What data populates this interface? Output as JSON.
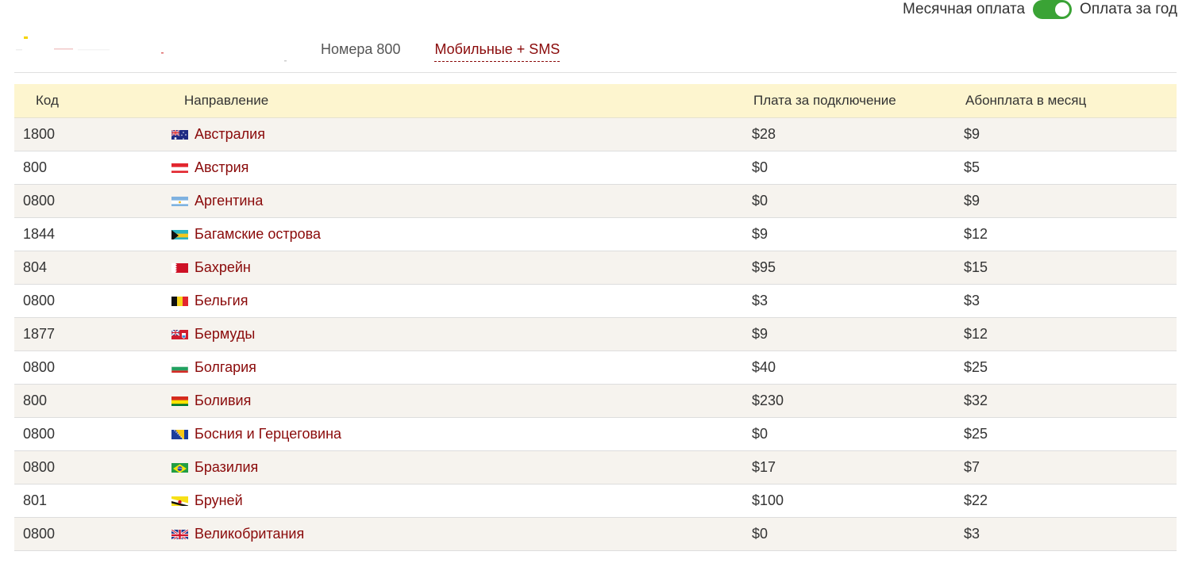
{
  "billing": {
    "monthly_label": "Месячная оплата",
    "yearly_label": "Оплата за год",
    "toggle_color": "#3aa335"
  },
  "tabs": [
    {
      "label": "Номера 800",
      "active": false
    },
    {
      "label": "Мобильные + SMS",
      "active": true
    }
  ],
  "table": {
    "headers": {
      "code": "Код",
      "direction": "Направление",
      "connection_fee": "Плата за подключение",
      "monthly_fee": "Абонплата в месяц"
    },
    "rows": [
      {
        "code": "1800",
        "country": "Австралия",
        "flag": "au-flag-icon",
        "fee": "$28",
        "monthly": "$9"
      },
      {
        "code": "800",
        "country": "Австрия",
        "flag": "at-flag-icon",
        "fee": "$0",
        "monthly": "$5"
      },
      {
        "code": "0800",
        "country": "Аргентина",
        "flag": "ar-flag-icon",
        "fee": "$0",
        "monthly": "$9"
      },
      {
        "code": "1844",
        "country": "Багамские острова",
        "flag": "bs-flag-icon",
        "fee": "$9",
        "monthly": "$12"
      },
      {
        "code": "804",
        "country": "Бахрейн",
        "flag": "bh-flag-icon",
        "fee": "$95",
        "monthly": "$15"
      },
      {
        "code": "0800",
        "country": "Бельгия",
        "flag": "be-flag-icon",
        "fee": "$3",
        "monthly": "$3"
      },
      {
        "code": "1877",
        "country": "Бермуды",
        "flag": "bm-flag-icon",
        "fee": "$9",
        "monthly": "$12"
      },
      {
        "code": "0800",
        "country": "Болгария",
        "flag": "bg-flag-icon",
        "fee": "$40",
        "monthly": "$25"
      },
      {
        "code": "800",
        "country": "Боливия",
        "flag": "bo-flag-icon",
        "fee": "$230",
        "monthly": "$32"
      },
      {
        "code": "0800",
        "country": "Босния и Герцеговина",
        "flag": "ba-flag-icon",
        "fee": "$0",
        "monthly": "$25"
      },
      {
        "code": "0800",
        "country": "Бразилия",
        "flag": "br-flag-icon",
        "fee": "$17",
        "monthly": "$7"
      },
      {
        "code": "801",
        "country": "Бруней",
        "flag": "bn-flag-icon",
        "fee": "$100",
        "monthly": "$22"
      },
      {
        "code": "0800",
        "country": "Великобритания",
        "flag": "gb-flag-icon",
        "fee": "$0",
        "monthly": "$3"
      }
    ]
  },
  "colors": {
    "link": "#8a0a0a",
    "header_bg": "#fdf5cf",
    "row_alt_bg": "#f6f3ee"
  }
}
